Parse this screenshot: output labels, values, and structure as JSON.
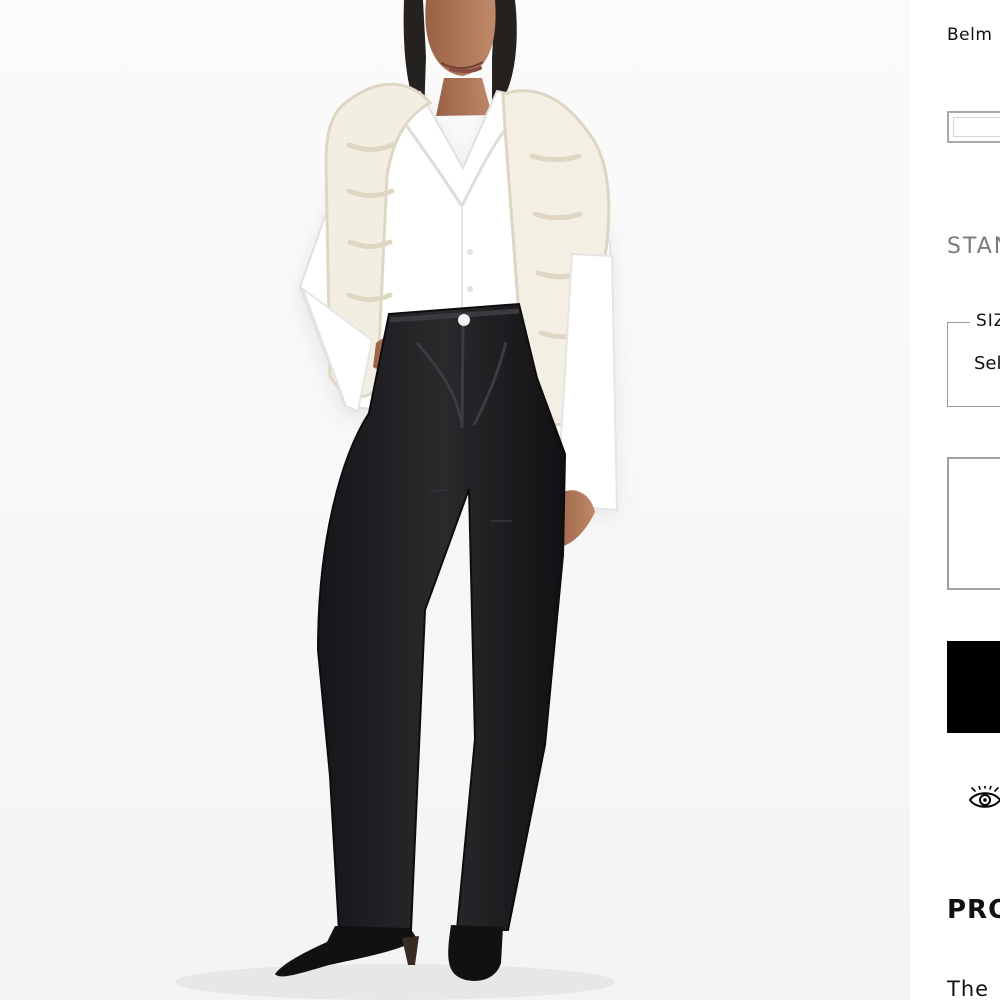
{
  "product": {
    "image_alt": "Model wearing black straight jeans with a white shirt and cream sweater over shoulders",
    "color_name": "Belm",
    "fit_label": "STAN",
    "size_select": {
      "legend": "SIZ",
      "value": "Sel"
    },
    "section_heading": "PRO",
    "description_start": "The"
  },
  "colors": {
    "accent": "#000000",
    "muted_text": "#7b7b7b",
    "border": "#a0a0a0"
  },
  "icons": {
    "viewers": "eye-icon"
  }
}
